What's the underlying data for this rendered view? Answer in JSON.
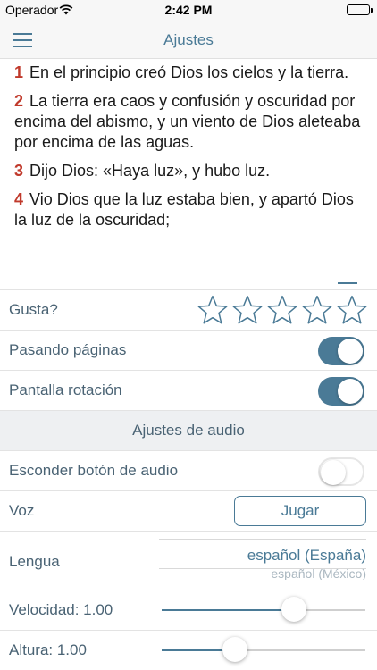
{
  "status_bar": {
    "carrier": "Operador",
    "time": "2:42 PM",
    "battery_level": 1.0
  },
  "navbar": {
    "title": "Ajustes",
    "menu_icon": "hamburger-menu-icon"
  },
  "verses": [
    {
      "num": "1",
      "text": "En el principio creó Dios los cielos y la tierra."
    },
    {
      "num": "2",
      "text": "La tierra era caos y confusión y oscuridad por encima del abismo, y un viento de Dios aleteaba por encima de las aguas."
    },
    {
      "num": "3",
      "text": "Dijo Dios: «Haya luz», y hubo luz."
    },
    {
      "num": "4",
      "text": "Vio Dios que la luz estaba bien, y apartó Dios la luz de la oscuridad;"
    }
  ],
  "settings": {
    "rating": {
      "label": "Gusta?",
      "stars": 5,
      "value": 0
    },
    "page_turn": {
      "label": "Pasando páginas",
      "on": true
    },
    "rotation": {
      "label": "Pantalla rotación",
      "on": true
    }
  },
  "audio": {
    "header": "Ajustes de audio",
    "hide_button": {
      "label": "Esconder botón de audio",
      "on": false
    },
    "voice": {
      "label": "Voz",
      "button_label": "Jugar"
    },
    "language": {
      "label": "Lengua",
      "selected": "español (España)",
      "next": "español (México)"
    },
    "speed": {
      "label": "Velocidad: 1.00",
      "position": 0.65
    },
    "pitch": {
      "label": "Altura: 1.00",
      "position": 0.36
    }
  },
  "colors": {
    "accent": "#4a7a96",
    "verse_number": "#c0392b",
    "label": "#4a6374"
  }
}
